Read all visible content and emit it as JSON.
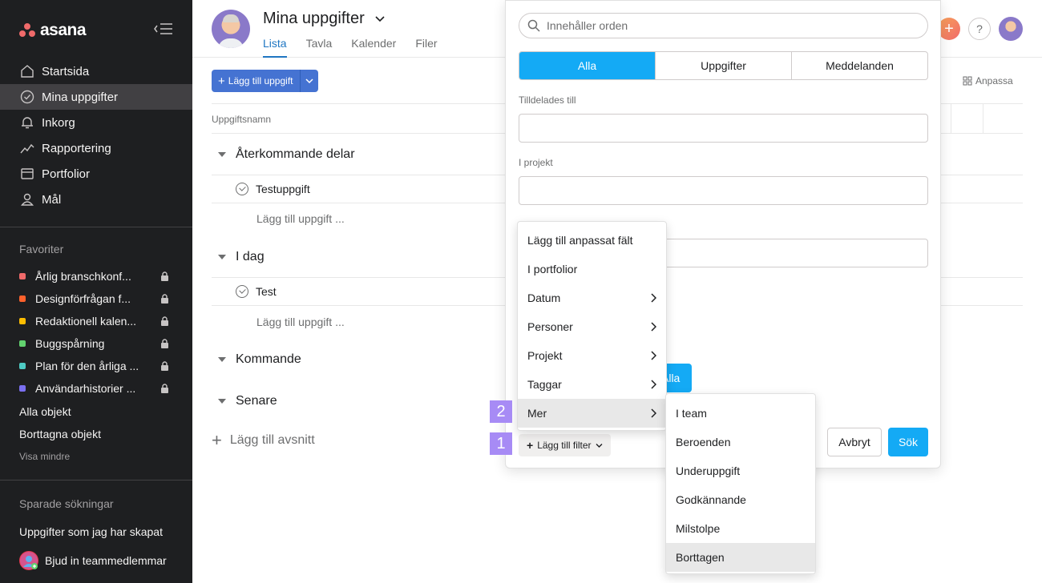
{
  "sidebar": {
    "logo": "asana",
    "nav": [
      {
        "label": "Startsida",
        "icon": "home-icon"
      },
      {
        "label": "Mina uppgifter",
        "icon": "check-circle-icon",
        "active": true
      },
      {
        "label": "Inkorg",
        "icon": "bell-icon"
      },
      {
        "label": "Rapportering",
        "icon": "chart-line-icon"
      },
      {
        "label": "Portfolior",
        "icon": "folder-icon"
      },
      {
        "label": "Mål",
        "icon": "person-icon"
      }
    ],
    "favorites_heading": "Favoriter",
    "favorites": [
      {
        "label": "Årlig branschkonf...",
        "color": "#f06a6a"
      },
      {
        "label": "Designförfrågan f...",
        "color": "#fd612c"
      },
      {
        "label": "Redaktionell kalen...",
        "color": "#fcbd01"
      },
      {
        "label": "Buggspårning",
        "color": "#62d26f"
      },
      {
        "label": "Plan för den årliga ...",
        "color": "#4ecbc4"
      },
      {
        "label": "Användarhistorier ...",
        "color": "#7a6ff0"
      }
    ],
    "all_objects": "Alla objekt",
    "deleted_objects": "Borttagna objekt",
    "show_less": "Visa mindre",
    "saved_heading": "Sparade sökningar",
    "saved_item": "Uppgifter som jag har skapat",
    "invite": "Bjud in teammedlemmar"
  },
  "header": {
    "title": "Mina uppgifter",
    "tabs": [
      "Lista",
      "Tavla",
      "Kalender",
      "Filer"
    ],
    "help": "?"
  },
  "toolbar": {
    "add_task": "Lägg till uppgift",
    "customize": "Anpassa"
  },
  "list": {
    "column_task_name": "Uppgiftsnamn",
    "sections": [
      {
        "title": "Återkommande delar",
        "task": "Testuppgift",
        "add": "Lägg till uppgift ..."
      },
      {
        "title": "I dag",
        "task": "Test",
        "add": "Lägg till uppgift ..."
      },
      {
        "title": "Kommande"
      },
      {
        "title": "Senare"
      }
    ],
    "add_section": "Lägg till avsnitt"
  },
  "search": {
    "placeholder": "Innehåller orden",
    "segments": [
      "Alla",
      "Uppgifter",
      "Meddelanden"
    ],
    "assigned_label": "Tilldelades till",
    "project_label": "I projekt",
    "alla_btn": "Alla",
    "add_filter": "Lägg till filter",
    "cancel": "Avbryt",
    "search": "Sök"
  },
  "filter_menu": [
    {
      "label": "Lägg till anpassat fält",
      "sub": false
    },
    {
      "label": "I portfolior",
      "sub": false
    },
    {
      "label": "Datum",
      "sub": true
    },
    {
      "label": "Personer",
      "sub": true
    },
    {
      "label": "Projekt",
      "sub": true
    },
    {
      "label": "Taggar",
      "sub": true
    },
    {
      "label": "Mer",
      "sub": true,
      "hover": true
    }
  ],
  "more_menu": [
    {
      "label": "I team"
    },
    {
      "label": "Beroenden"
    },
    {
      "label": "Underuppgift"
    },
    {
      "label": "Godkännande"
    },
    {
      "label": "Milstolpe"
    },
    {
      "label": "Borttagen",
      "hover": true
    }
  ],
  "badges": {
    "one": "1",
    "two": "2"
  }
}
